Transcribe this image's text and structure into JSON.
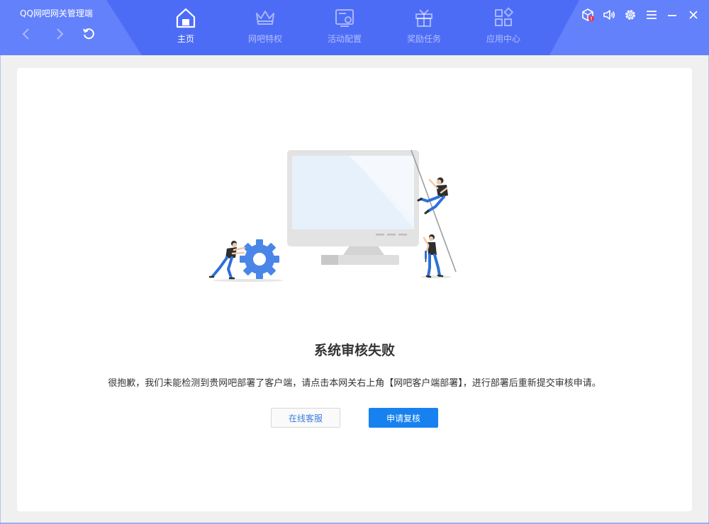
{
  "app": {
    "title": "QQ网吧网关管理端"
  },
  "nav": {
    "back_icon": "chevron-left-icon",
    "forward_icon": "chevron-right-icon",
    "refresh_icon": "refresh-icon"
  },
  "tabs": [
    {
      "label": "主页",
      "icon": "home-icon",
      "active": true
    },
    {
      "label": "网吧特权",
      "icon": "crown-icon",
      "active": false
    },
    {
      "label": "活动配置",
      "icon": "settings-screen-icon",
      "active": false
    },
    {
      "label": "奖励任务",
      "icon": "gift-icon",
      "active": false
    },
    {
      "label": "应用中心",
      "icon": "apps-grid-icon",
      "active": false
    }
  ],
  "window_controls": [
    "alert-cube-icon",
    "volume-icon",
    "gear-icon",
    "menu-icon",
    "minimize-icon",
    "close-icon"
  ],
  "main": {
    "heading": "系统审核失败",
    "description": "很抱歉，我们未能检测到贵网吧部署了客户端，请点击本网关右上角【网吧客户端部署】，进行部署后重新提交审核申请。",
    "secondary_button": "在线客服",
    "primary_button": "申请复核"
  },
  "colors": {
    "titlebar": "#4d6cf6",
    "titlebar_band": "#6381fb",
    "primary_button": "#1781f0",
    "gear": "#4a86e8",
    "alert_dot": "#e8334a"
  }
}
